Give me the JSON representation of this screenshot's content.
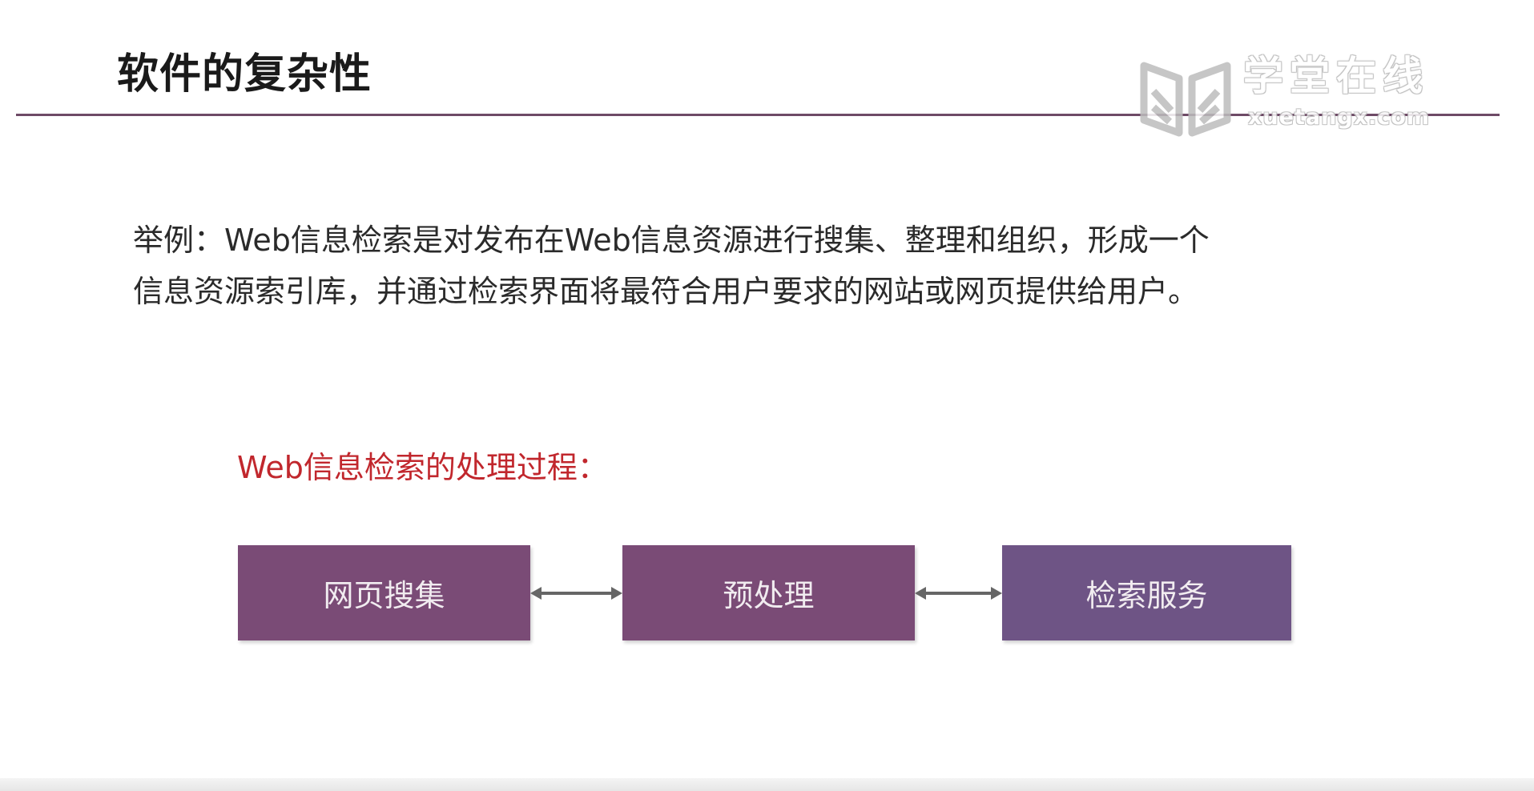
{
  "slide": {
    "title": "软件的复杂性",
    "watermark": {
      "name_cn": "学堂在线",
      "name_en": "xuetangx.com",
      "logo_icon": "book-logo-icon"
    },
    "body_lines": [
      "举例：Web信息检索是对发布在Web信息资源进行搜集、整理和组织，形成一个",
      "信息资源索引库，并通过检索界面将最符合用户要求的网站或网页提供给用户。"
    ],
    "process_heading": "Web信息检索的处理过程：",
    "process_steps": [
      {
        "label": "网页搜集",
        "color": "#7a4b76"
      },
      {
        "label": "预处理",
        "color": "#7a4b76"
      },
      {
        "label": "检索服务",
        "color": "#6e5485"
      }
    ],
    "colors": {
      "title_rule": "#6e4a66",
      "heading_red": "#c1272d",
      "arrow": "#666666"
    }
  }
}
